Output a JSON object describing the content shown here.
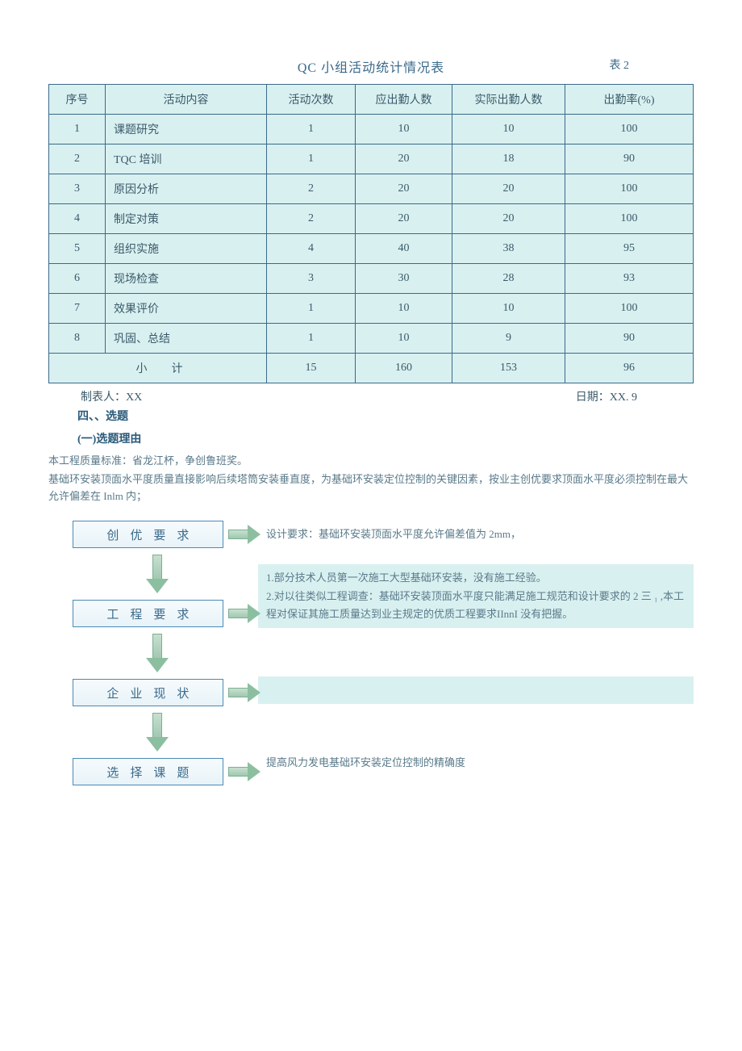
{
  "title": "QC 小组活动统计情况表",
  "table_label": "表 2",
  "headers": [
    "序号",
    "活动内容",
    "活动次数",
    "应出勤人数",
    "实际出勤人数",
    "出勤率(%)"
  ],
  "rows": [
    {
      "n": "1",
      "content": "课题研究",
      "times": "1",
      "should": "10",
      "actual": "10",
      "rate": "100"
    },
    {
      "n": "2",
      "content": "TQC 培训",
      "times": "1",
      "should": "20",
      "actual": "18",
      "rate": "90"
    },
    {
      "n": "3",
      "content": "原因分析",
      "times": "2",
      "should": "20",
      "actual": "20",
      "rate": "100"
    },
    {
      "n": "4",
      "content": "制定对策",
      "times": "2",
      "should": "20",
      "actual": "20",
      "rate": "100"
    },
    {
      "n": "5",
      "content": "组织实施",
      "times": "4",
      "should": "40",
      "actual": "38",
      "rate": "95"
    },
    {
      "n": "6",
      "content": "现场检查",
      "times": "3",
      "should": "30",
      "actual": "28",
      "rate": "93"
    },
    {
      "n": "7",
      "content": "效果评价",
      "times": "1",
      "should": "10",
      "actual": "10",
      "rate": "100"
    },
    {
      "n": "8",
      "content": "巩固、总结",
      "times": "1",
      "should": "10",
      "actual": "9",
      "rate": "90"
    }
  ],
  "subtotal": {
    "label": "小计",
    "times": "15",
    "should": "160",
    "actual": "153",
    "rate": "96"
  },
  "maker": "制表人：XX",
  "date": "日期：XX. 9",
  "sec4": "四、、选题",
  "sub1": "(一)选题理由",
  "para1": "本工程质量标准：省龙江杯，争创鲁班奖。",
  "para2": "基础环安装顶面水平度质量直接影响后续塔筒安装垂直度，为基础环安装定位控制的关键因素，按业主创优要求顶面水平度必须控制在最大允许偏差在 Inlm 内；",
  "box1": "创优要求",
  "box2": "工程要求",
  "box3": "企业现状",
  "box4": "选择课题",
  "note1": "设计要求：基础环安装顶面水平度允许偏差值为 2mm，",
  "note2": "1.部分技术人员第一次施工大型基础环安装，没有施工经验。\n2.对以往类似工程调查：基础环安装顶面水平度只能满足施工规范和设计要求的 2 三 ₁ ,本工程对保证其施工质量达到业主规定的优质工程要求IInnI 没有把握。",
  "note4": "提高风力发电基础环安装定位控制的精确度",
  "chart_data": {
    "type": "table",
    "title": "QC 小组活动统计情况表",
    "columns": [
      "序号",
      "活动内容",
      "活动次数",
      "应出勤人数",
      "实际出勤人数",
      "出勤率(%)"
    ],
    "data": [
      [
        1,
        "课题研究",
        1,
        10,
        10,
        100
      ],
      [
        2,
        "TQC 培训",
        1,
        20,
        18,
        90
      ],
      [
        3,
        "原因分析",
        2,
        20,
        20,
        100
      ],
      [
        4,
        "制定对策",
        2,
        20,
        20,
        100
      ],
      [
        5,
        "组织实施",
        4,
        40,
        38,
        95
      ],
      [
        6,
        "现场检查",
        3,
        30,
        28,
        93
      ],
      [
        7,
        "效果评价",
        1,
        10,
        10,
        100
      ],
      [
        8,
        "巩固、总结",
        1,
        10,
        9,
        90
      ]
    ],
    "subtotal": [
      "小计",
      15,
      160,
      153,
      96
    ]
  }
}
